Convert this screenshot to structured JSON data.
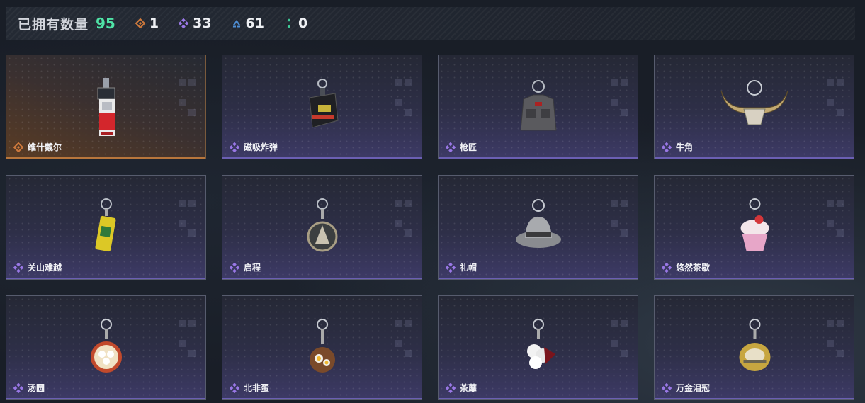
{
  "header": {
    "owned_label": "已拥有数量",
    "owned_count": "95",
    "stats": [
      {
        "icon": "orange-diamond-icon",
        "value": "1",
        "color": "#d07a3c"
      },
      {
        "icon": "purple-diamond-icon",
        "value": "33",
        "color": "#9a78e6"
      },
      {
        "icon": "blue-chevron-icon",
        "value": "61",
        "color": "#4f8fd6"
      },
      {
        "icon": "green-dots-icon",
        "value": "0",
        "color": "#3fcf9a"
      }
    ]
  },
  "items": [
    {
      "name": "维什戴尔",
      "rarity": "orange",
      "pendant": "card-device"
    },
    {
      "name": "磁吸炸弹",
      "rarity": "purple",
      "pendant": "bomb"
    },
    {
      "name": "枪匠",
      "rarity": "purple",
      "pendant": "vest"
    },
    {
      "name": "牛角",
      "rarity": "purple",
      "pendant": "horns"
    },
    {
      "name": "关山难越",
      "rarity": "purple",
      "pendant": "can"
    },
    {
      "name": "启程",
      "rarity": "purple",
      "pendant": "medal"
    },
    {
      "name": "礼帽",
      "rarity": "purple",
      "pendant": "hat"
    },
    {
      "name": "悠然茶歇",
      "rarity": "purple",
      "pendant": "cupcake"
    },
    {
      "name": "汤圆",
      "rarity": "purple",
      "pendant": "bowl"
    },
    {
      "name": "北非蛋",
      "rarity": "purple",
      "pendant": "pan"
    },
    {
      "name": "茶蘼",
      "rarity": "purple",
      "pendant": "flower"
    },
    {
      "name": "万金泪冠",
      "rarity": "purple",
      "pendant": "crown"
    }
  ]
}
